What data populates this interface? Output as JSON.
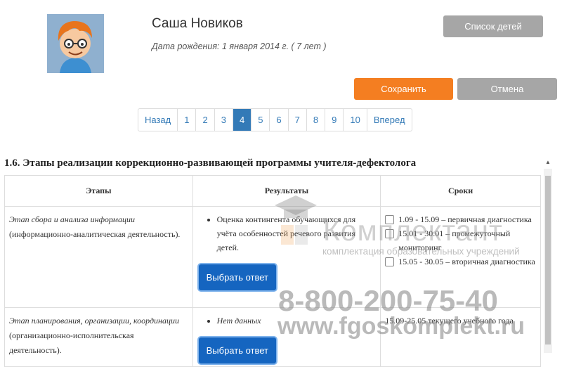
{
  "profile": {
    "name": "Саша Новиков",
    "dob": "Дата рождения: 1 января 2014 г. ( 7 лет )",
    "avatar_icon": "cartoon-boy-avatar"
  },
  "buttons": {
    "kids_list": "Список детей",
    "save": "Сохранить",
    "cancel": "Отмена"
  },
  "pagination": {
    "prev": "Назад",
    "next": "Вперед",
    "pages": [
      "1",
      "2",
      "3",
      "4",
      "5",
      "6",
      "7",
      "8",
      "9",
      "10"
    ],
    "active": "4"
  },
  "section": {
    "title": "1.6. Этапы реализации коррекционно-развивающей программы учителя-дефектолога"
  },
  "table": {
    "headers": [
      "Этапы",
      "Результаты",
      "Сроки"
    ],
    "rows": [
      {
        "stage_title": "Этап сбора и анализа информации",
        "stage_desc": "(информационно-аналитическая деятельность).",
        "result": "Оценка контингента обучающихся для учёта особенностей речевого развития детей.",
        "choose": "Выбрать ответ",
        "terms": [
          "1.09 - 15.09 – первичная диагностика",
          "15.01 - 30.01 – промежуточный мониторинг",
          "15.05 - 30.05 – вторичная диагностика"
        ]
      },
      {
        "stage_title": "Этап планирования, организации, координации",
        "stage_desc": "(организационно-исполнительская деятельность).",
        "result": "Нет данных",
        "choose": "Выбрать ответ",
        "terms_text": "15.09-25.05 текущего учебного года"
      }
    ]
  },
  "watermark": {
    "brand": "Комплектант",
    "sub": "комплектация образовательных учреждений",
    "phone": "8-800-200-75-40",
    "url": "www.fgoskomplekt.ru"
  },
  "colors": {
    "save": "#f47e21",
    "grey_button": "#a6a6a6",
    "pager_active": "#337ab7",
    "choose_button": "#1565c0"
  }
}
